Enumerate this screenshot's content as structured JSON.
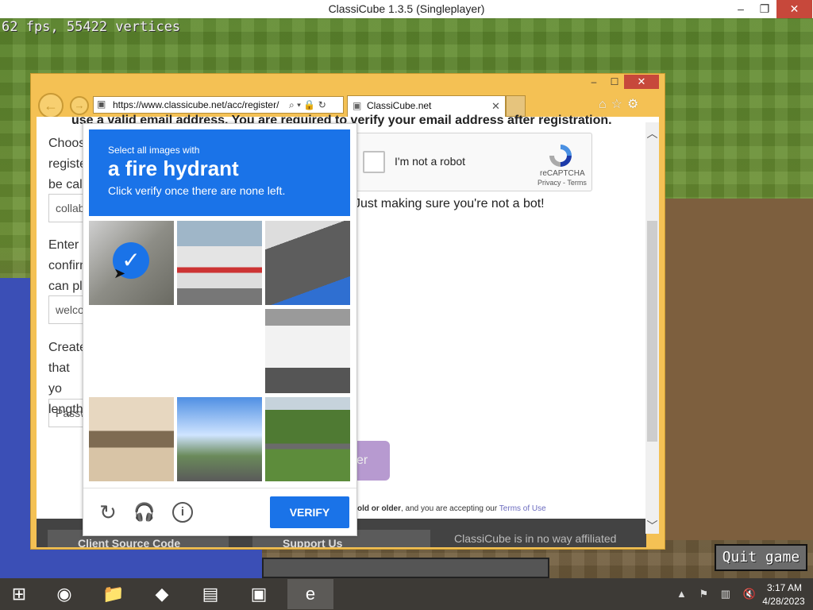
{
  "game": {
    "title": "ClassiCube 1.3.5 (Singleplayer)",
    "stats": "62 fps, 55422 vertices",
    "quit_label": "Quit game",
    "controls": {
      "minimize": "–",
      "maximize": "❐",
      "close": "✕"
    }
  },
  "browser": {
    "controls": {
      "minimize": "–",
      "maximize": "☐",
      "close": "✕"
    },
    "back": "←",
    "forward": "→",
    "url": "https://www.classicube.net/acc/register/",
    "addr_tools": "⌕ ▾ 🔒 ↻",
    "tab_label": "ClassiCube.net",
    "tab_close": "✕",
    "toolbar_icons": "⌂☆⚙"
  },
  "page": {
    "intro": "use a valid email address. You are required to verify your email address after registration.",
    "label1": "Choose registe be cal",
    "input1": "collab",
    "label2": "Enter confirm can pl",
    "input2": "welco",
    "label3": "Create that yo length",
    "input3": "Passw",
    "recaptcha": {
      "label": "I'm not a robot",
      "brand": "reCAPTCHA",
      "links": "Privacy - Terms"
    },
    "bot_note": "Just making sure you're not a bot!",
    "register_fragment": "er",
    "terms_prefix": "old or older",
    "terms_middle": ", and you are accepting our ",
    "terms_link": "Terms of Use",
    "footer_btn1": "Client Source Code",
    "footer_btn2": "Support Us",
    "footer_note": "ClassiCube is in no way affiliated"
  },
  "challenge": {
    "instruction_small": "Select all images with",
    "target": "a fire hydrant",
    "instruction_sub": "Click verify once there are none left.",
    "verify_label": "VERIFY",
    "check_mark": "✓",
    "reload_icon": "↻",
    "audio_icon": "🎧",
    "info_icon": "i"
  },
  "taskbar": {
    "start": "⊞",
    "apps": [
      "◉",
      "📁",
      "◆",
      "▤",
      "▣",
      "e"
    ],
    "tray": "▲ ⚑ ▥ 🔇",
    "time": "3:17 AM",
    "date": "4/28/2023"
  },
  "colors": {
    "accent": "#1a73e8",
    "browser_frame": "#f4c154",
    "close_red": "#c7483b"
  }
}
